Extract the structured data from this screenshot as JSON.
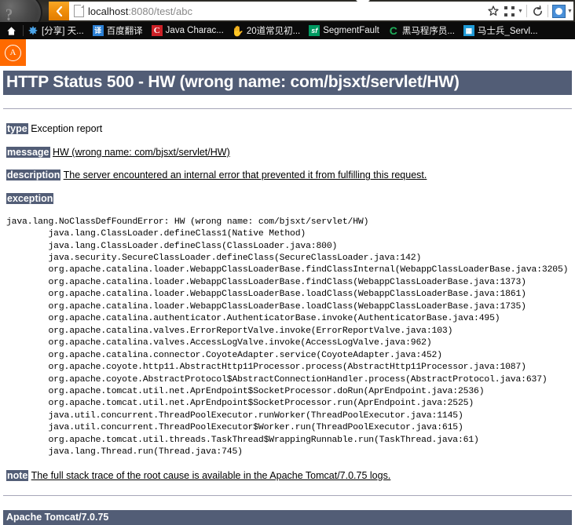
{
  "browser": {
    "back_label": "Back",
    "url_host": "localhost",
    "url_rest": ":8080/test/abc",
    "url_full": "localhost:8080/test/abc",
    "page_icon": "document-icon",
    "toolbar_icons": [
      "star-icon",
      "qr-code-icon",
      "reload-icon",
      "extension-icon"
    ],
    "reload_glyph": "↻"
  },
  "bookmarks": {
    "home_glyph": "⌂",
    "items": [
      {
        "icon_glyph": "✸",
        "icon_class": "ic-star",
        "icon_name": "sparkle-icon",
        "label": "[分享] 天..."
      },
      {
        "icon_glyph": "译",
        "icon_class": "ic-fanyi",
        "icon_name": "baidu-translate-icon",
        "label": "百度翻译"
      },
      {
        "icon_glyph": "C",
        "icon_class": "ic-c",
        "icon_name": "c-letter-icon",
        "label": "Java Charac..."
      },
      {
        "icon_glyph": "✋",
        "icon_class": "ic-hand",
        "icon_name": "hand-icon",
        "label": "20道常见初..."
      },
      {
        "icon_glyph": "sf",
        "icon_class": "ic-sf",
        "icon_name": "segmentfault-icon",
        "label": "SegmentFault"
      },
      {
        "icon_glyph": "C",
        "icon_class": "ic-cgreen",
        "icon_name": "green-c-icon",
        "label": "黑马程序员..."
      },
      {
        "icon_glyph": "▦",
        "icon_class": "ic-cal",
        "icon_name": "calendar-icon",
        "label": "马士兵_Servl..."
      }
    ]
  },
  "favicon_tile": {
    "glyph": "A",
    "color": "#ff6a00"
  },
  "error_page": {
    "title": "HTTP Status 500 - HW (wrong name: com/bjsxt/servlet/HW)",
    "accent_color": "#525D76",
    "type_label": "type",
    "type_value": "Exception report",
    "message_label": "message",
    "message_value": "HW (wrong name: com/bjsxt/servlet/HW)",
    "description_label": "description",
    "description_value": "The server encountered an internal error that prevented it from fulfilling this request.",
    "exception_label": "exception",
    "stack_trace": "java.lang.NoClassDefFoundError: HW (wrong name: com/bjsxt/servlet/HW)\n\tjava.lang.ClassLoader.defineClass1(Native Method)\n\tjava.lang.ClassLoader.defineClass(ClassLoader.java:800)\n\tjava.security.SecureClassLoader.defineClass(SecureClassLoader.java:142)\n\torg.apache.catalina.loader.WebappClassLoaderBase.findClassInternal(WebappClassLoaderBase.java:3205)\n\torg.apache.catalina.loader.WebappClassLoaderBase.findClass(WebappClassLoaderBase.java:1373)\n\torg.apache.catalina.loader.WebappClassLoaderBase.loadClass(WebappClassLoaderBase.java:1861)\n\torg.apache.catalina.loader.WebappClassLoaderBase.loadClass(WebappClassLoaderBase.java:1735)\n\torg.apache.catalina.authenticator.AuthenticatorBase.invoke(AuthenticatorBase.java:495)\n\torg.apache.catalina.valves.ErrorReportValve.invoke(ErrorReportValve.java:103)\n\torg.apache.catalina.valves.AccessLogValve.invoke(AccessLogValve.java:962)\n\torg.apache.catalina.connector.CoyoteAdapter.service(CoyoteAdapter.java:452)\n\torg.apache.coyote.http11.AbstractHttp11Processor.process(AbstractHttp11Processor.java:1087)\n\torg.apache.coyote.AbstractProtocol$AbstractConnectionHandler.process(AbstractProtocol.java:637)\n\torg.apache.tomcat.util.net.AprEndpoint$SocketProcessor.doRun(AprEndpoint.java:2536)\n\torg.apache.tomcat.util.net.AprEndpoint$SocketProcessor.run(AprEndpoint.java:2525)\n\tjava.util.concurrent.ThreadPoolExecutor.runWorker(ThreadPoolExecutor.java:1145)\n\tjava.util.concurrent.ThreadPoolExecutor$Worker.run(ThreadPoolExecutor.java:615)\n\torg.apache.tomcat.util.threads.TaskThread$WrappingRunnable.run(TaskThread.java:61)\n\tjava.lang.Thread.run(Thread.java:745)",
    "note_label": "note",
    "note_value": "The full stack trace of the root cause is available in the Apache Tomcat/7.0.75 logs.",
    "footer": "Apache Tomcat/7.0.75"
  }
}
